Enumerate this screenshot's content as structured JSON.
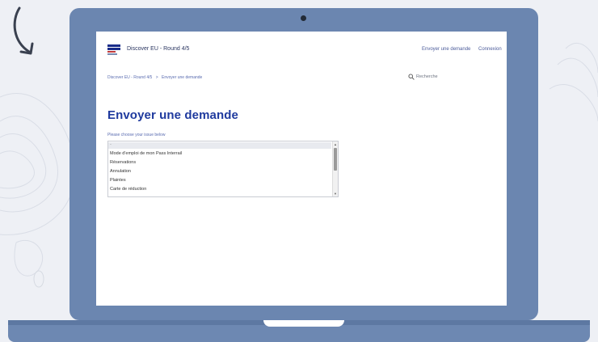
{
  "site": {
    "brand": "Discover EU - Round 4/5",
    "nav_request": "Envoyer une demande",
    "nav_login": "Connexion"
  },
  "breadcrumb": {
    "items": [
      "Discover EU - Round 4/5",
      ">",
      "Envoyer une demande"
    ]
  },
  "search": {
    "placeholder": "Recherche"
  },
  "page": {
    "title": "Envoyer une demande",
    "issue_label": "Please choose your issue below"
  },
  "issue_options": [
    "-",
    "Mode d'emploi de mon Pass Interrail",
    "Réservations",
    "Annulation",
    "Plaintes",
    "Carte de réduction"
  ],
  "colors": {
    "frame": "#6b86b0",
    "title": "#1f3a9e",
    "link": "#5a6cb0"
  }
}
